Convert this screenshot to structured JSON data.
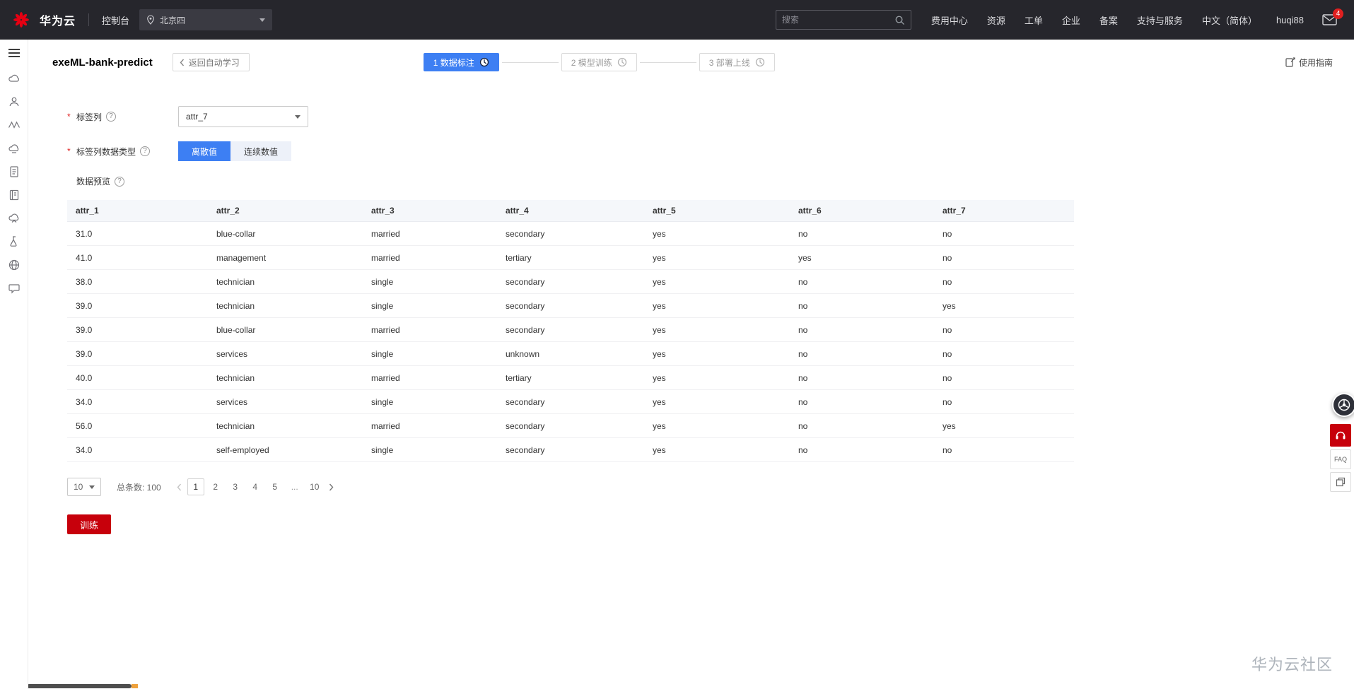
{
  "topnav": {
    "brand": "华为云",
    "console_label": "控制台",
    "region": "北京四",
    "search_placeholder": "搜索",
    "menu": [
      "费用中心",
      "资源",
      "工单",
      "企业",
      "备案",
      "支持与服务",
      "中文（简体）",
      "huqi88"
    ],
    "mail_badge": "4"
  },
  "page": {
    "title": "exeML-bank-predict",
    "back_button": "返回自动学习",
    "guide_link": "使用指南",
    "steps": [
      {
        "label": "1 数据标注",
        "active": true
      },
      {
        "label": "2 模型训练",
        "active": false
      },
      {
        "label": "3 部署上线",
        "active": false
      }
    ]
  },
  "form": {
    "required_marker": "*",
    "label_col_label": "标签列",
    "label_col_value": "attr_7",
    "dtype_label": "标签列数据类型",
    "dtype_options": [
      "离散值",
      "连续数值"
    ],
    "dtype_active": "离散值",
    "preview_label": "数据预览"
  },
  "table": {
    "columns": [
      "attr_1",
      "attr_2",
      "attr_3",
      "attr_4",
      "attr_5",
      "attr_6",
      "attr_7"
    ],
    "rows": [
      [
        "31.0",
        "blue-collar",
        "married",
        "secondary",
        "yes",
        "no",
        "no"
      ],
      [
        "41.0",
        "management",
        "married",
        "tertiary",
        "yes",
        "yes",
        "no"
      ],
      [
        "38.0",
        "technician",
        "single",
        "secondary",
        "yes",
        "no",
        "no"
      ],
      [
        "39.0",
        "technician",
        "single",
        "secondary",
        "yes",
        "no",
        "yes"
      ],
      [
        "39.0",
        "blue-collar",
        "married",
        "secondary",
        "yes",
        "no",
        "no"
      ],
      [
        "39.0",
        "services",
        "single",
        "unknown",
        "yes",
        "no",
        "no"
      ],
      [
        "40.0",
        "technician",
        "married",
        "tertiary",
        "yes",
        "no",
        "no"
      ],
      [
        "34.0",
        "services",
        "single",
        "secondary",
        "yes",
        "no",
        "no"
      ],
      [
        "56.0",
        "technician",
        "married",
        "secondary",
        "yes",
        "no",
        "yes"
      ],
      [
        "34.0",
        "self-employed",
        "single",
        "secondary",
        "yes",
        "no",
        "no"
      ]
    ]
  },
  "pagination": {
    "page_size": "10",
    "total_label": "总条数: 100",
    "pages": [
      "1",
      "2",
      "3",
      "4",
      "5",
      "...",
      "10"
    ],
    "current": "1"
  },
  "actions": {
    "train_label": "训练"
  },
  "floating": {
    "faq_label": "FAQ"
  },
  "footer": {
    "watermark": "华为云社区"
  },
  "icons": {
    "topnav": [
      "huawei-logo",
      "location-pin-icon",
      "caret-down-icon",
      "search-icon",
      "mail-icon"
    ],
    "sidebar": [
      "menu-icon",
      "cloud-server-icon",
      "user-group-icon",
      "modelarts-icon",
      "cloud-storage-icon",
      "document-icon",
      "notebook-icon",
      "cloud-eye-icon",
      "experiment-icon",
      "globe-icon",
      "support-chat-icon"
    ],
    "content": [
      "chevron-left-icon",
      "clock-icon",
      "guide-icon",
      "question-circle-icon",
      "prev-page-icon",
      "next-page-icon"
    ],
    "floating": [
      "assistant-wheel-icon",
      "headset-icon",
      "faq-icon",
      "feedback-icon"
    ]
  },
  "colors": {
    "accent_blue": "#3D7FF3",
    "brand_red": "#C7000B",
    "topbar_bg": "#26262C",
    "table_header_bg": "#F5F7FA"
  }
}
